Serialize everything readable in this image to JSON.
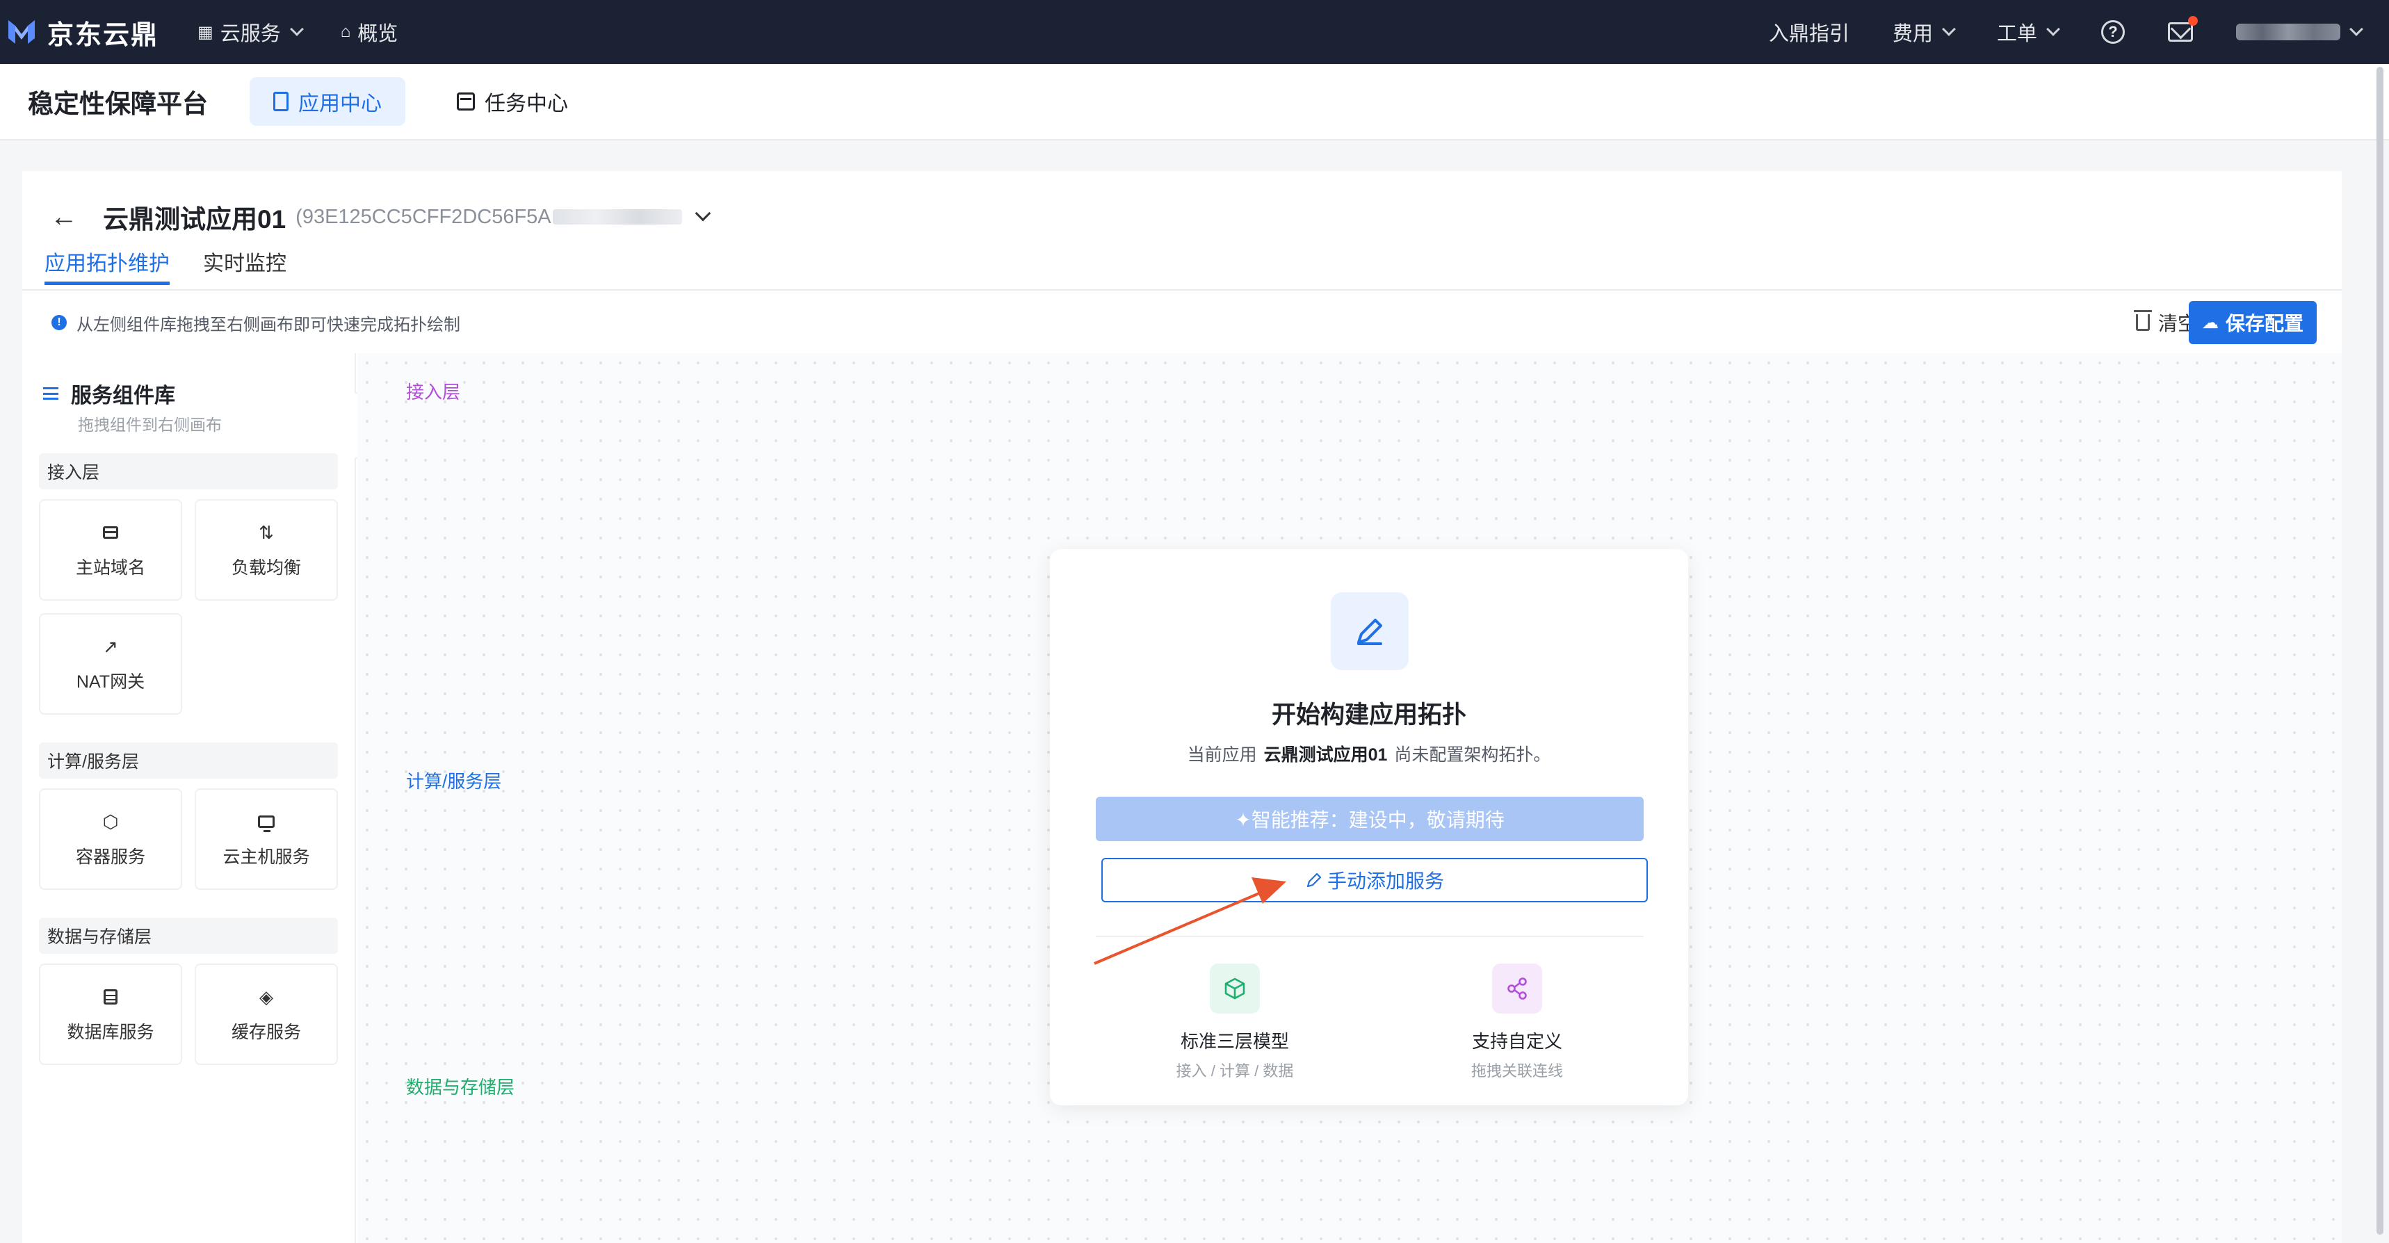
{
  "topbar": {
    "brand": "京东云鼎",
    "nav": [
      {
        "label": "云服务",
        "icon": "grid-icon"
      },
      {
        "label": "概览",
        "icon": "home-icon"
      }
    ],
    "right": {
      "guide": "入鼎指引",
      "billing": "费用",
      "ticket": "工单"
    }
  },
  "subheader": {
    "title": "稳定性保障平台",
    "tabs": [
      {
        "label": "应用中心",
        "active": true
      },
      {
        "label": "任务中心",
        "active": false
      }
    ]
  },
  "app": {
    "name": "云鼎测试应用01",
    "id_prefix": "(93E125CC5CFF2DC56F5A",
    "tabs": [
      {
        "label": "应用拓扑维护",
        "active": true
      },
      {
        "label": "实时监控",
        "active": false
      }
    ],
    "notice": "从左侧组件库拖拽至右侧画布即可快速完成拓扑绘制",
    "clear_label": "清空",
    "save_label": "保存配置"
  },
  "library": {
    "title": "服务组件库",
    "subtitle": "拖拽组件到右侧画布",
    "layers": [
      {
        "name": "接入层",
        "items": [
          {
            "label": "主站域名",
            "icon": "browser-window-icon"
          },
          {
            "label": "负载均衡",
            "icon": "swap-arrows-icon"
          },
          {
            "label": "NAT网关",
            "icon": "external-link-icon"
          }
        ]
      },
      {
        "name": "计算/服务层",
        "items": [
          {
            "label": "容器服务",
            "icon": "cube-icon"
          },
          {
            "label": "云主机服务",
            "icon": "monitor-icon"
          }
        ]
      },
      {
        "name": "数据与存储层",
        "items": [
          {
            "label": "数据库服务",
            "icon": "database-icon"
          },
          {
            "label": "缓存服务",
            "icon": "layers-icon"
          }
        ]
      }
    ]
  },
  "canvas": {
    "layers": [
      {
        "label": "接入层",
        "color": "#b24ddb"
      },
      {
        "label": "计算/服务层",
        "color": "#1f6fe5"
      },
      {
        "label": "数据与存储层",
        "color": "#1fae6e"
      }
    ]
  },
  "start_card": {
    "title": "开始构建应用拓扑",
    "desc_pre": "当前应用",
    "desc_app": "云鼎测试应用01",
    "desc_post": "尚未配置架构拓扑。",
    "smart_btn": "✦智能推荐：建设中，敬请期待",
    "manual_btn": "手动添加服务",
    "features": [
      {
        "title": "标准三层模型",
        "sub": "接入 / 计算 / 数据",
        "color": "#1fae6e",
        "bg": "#e6f7ef"
      },
      {
        "title": "支持自定义",
        "sub": "拖拽关联连线",
        "color": "#b24ddb",
        "bg": "#f5e9fb"
      }
    ]
  },
  "colors": {
    "primary": "#1f6fe5",
    "topbar_bg": "#1b2233",
    "annotation_arrow": "#e8542e"
  }
}
